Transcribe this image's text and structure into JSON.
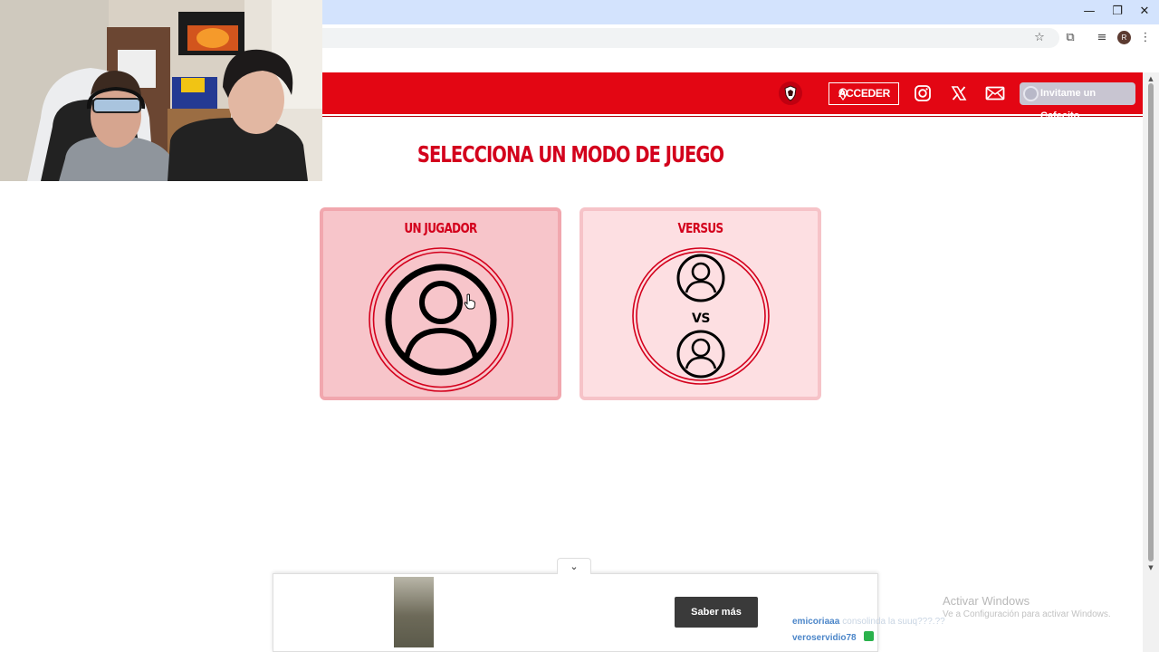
{
  "browser": {
    "window_controls": {
      "minimize": "—",
      "restore": "❐",
      "close": "✕"
    },
    "toolbar_icons": {
      "star": "☆",
      "extensions": "⧉",
      "media": "≡",
      "menu": "⋮"
    },
    "profile_initial": "R"
  },
  "header": {
    "login_label": "ACCEDER",
    "support_label": "Invitame un Cafecito",
    "social_icons": [
      "instagram-icon",
      "x-icon",
      "mail-icon"
    ],
    "brand_color": "#e30613"
  },
  "main": {
    "title": "SELECCIONA UN MODO DE JUEGO",
    "modes": [
      {
        "label": "UN JUGADOR",
        "selected": true
      },
      {
        "label": "VERSUS",
        "vs_text": "VS",
        "selected": false
      }
    ]
  },
  "ad": {
    "toggle_icon": "⌄",
    "cta_label": "Saber más"
  },
  "chat": [
    {
      "user": "emicoriaaa",
      "message": "consolinda la suuq???.??"
    },
    {
      "user": "veroservidio78",
      "message": ""
    }
  ],
  "watermark": {
    "line1": "Activar Windows",
    "line2": "Ve a Configuración para activar Windows."
  },
  "colors": {
    "title_red": "#d3001c",
    "card_single_bg": "#f7c5ca",
    "card_versus_bg": "#fddfe2",
    "button_dark": "#3a3a3a",
    "chrome_blue": "#d3e3fd"
  }
}
